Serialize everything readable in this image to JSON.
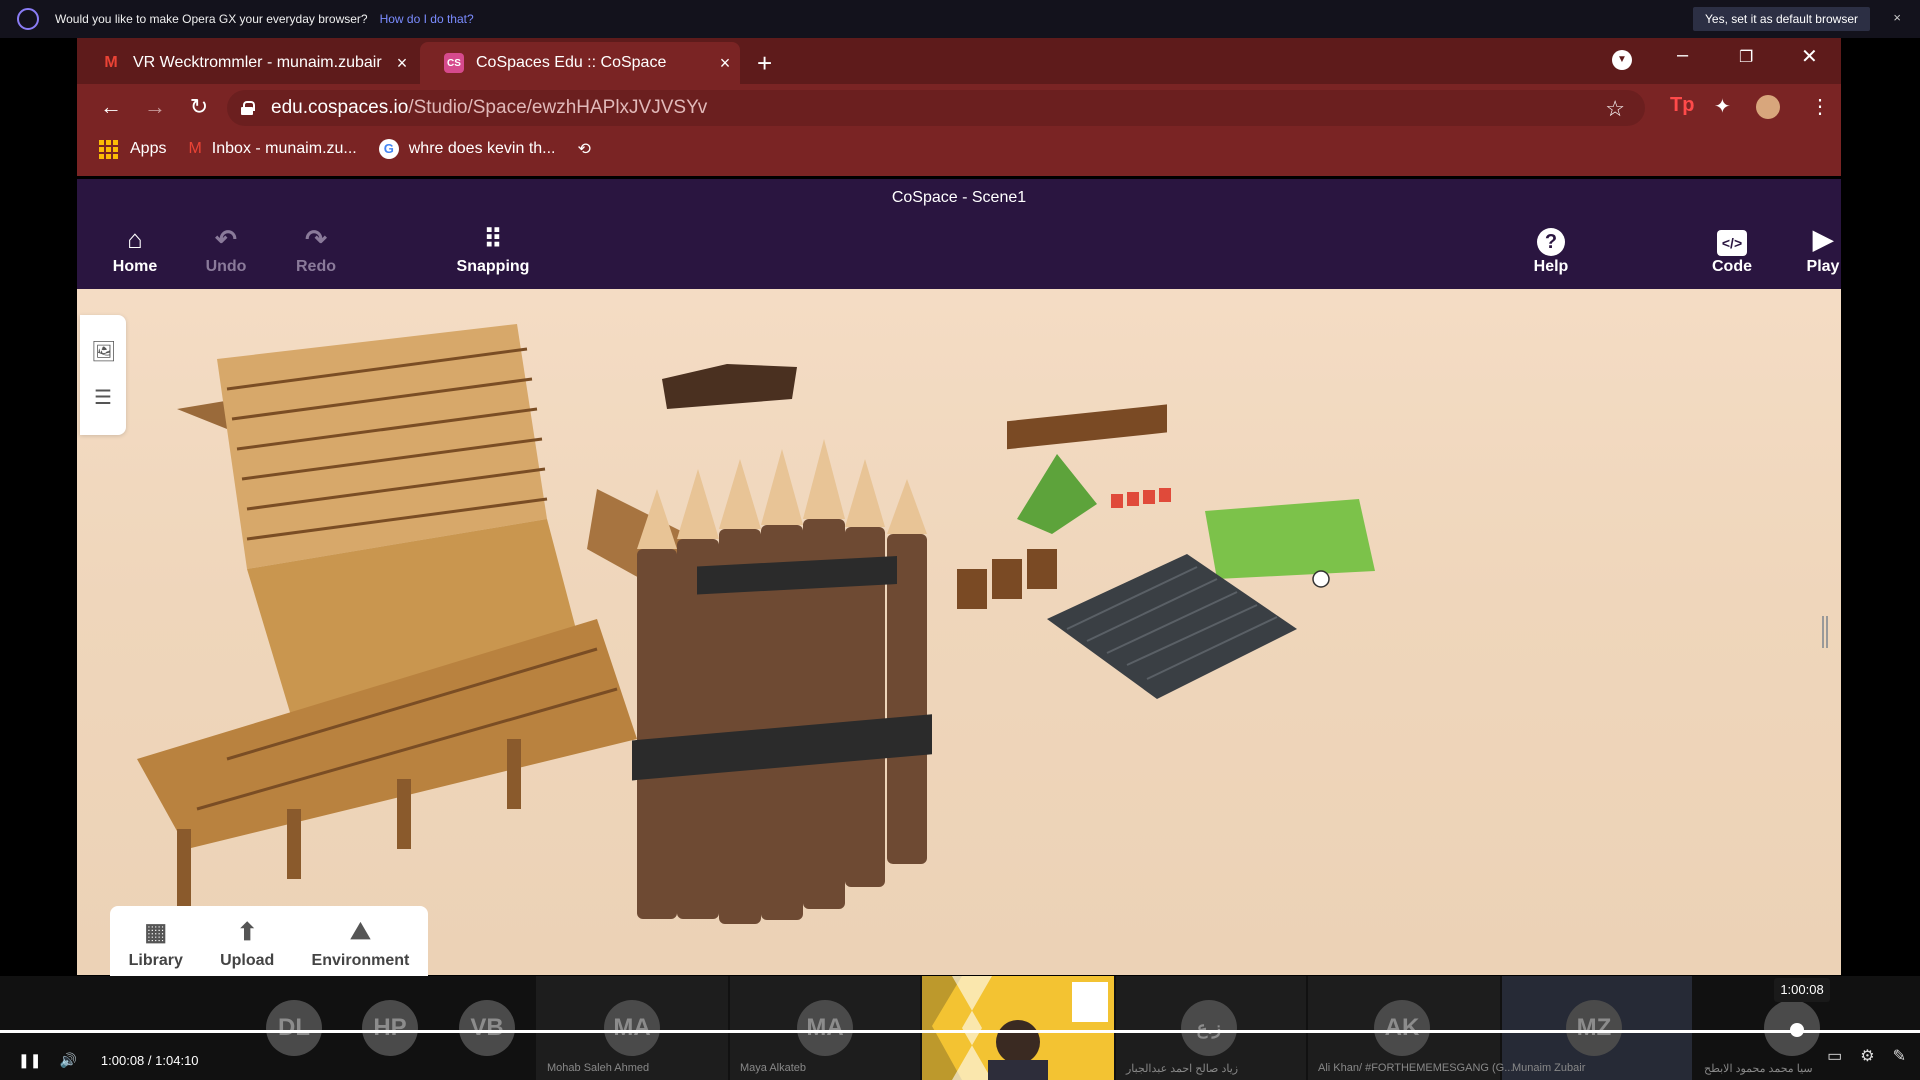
{
  "opera": {
    "prompt": "Would you like to make Opera GX your everyday browser?",
    "link": "How do I do that?",
    "default_button": "Yes, set it as default browser",
    "close": "×"
  },
  "tabs": [
    {
      "title": "VR Wecktrommler - munaim.zubair",
      "close": "×"
    },
    {
      "title": "CoSpaces Edu :: CoSpace",
      "close": "×"
    }
  ],
  "window": {
    "new_tab": "+",
    "minimize": "–",
    "restore": "❐",
    "close": "✕"
  },
  "toolbar": {
    "back": "←",
    "forward": "→",
    "reload": "↻",
    "url_host": "edu.cospaces.io",
    "url_path": "/Studio/Space/ewzhHAPlxJVJVSYv",
    "star": "☆"
  },
  "bookmarks": [
    {
      "label": "Apps"
    },
    {
      "label": "Inbox - munaim.zu..."
    },
    {
      "label": "whre does kevin th..."
    }
  ],
  "app": {
    "scene_title": "CoSpace - Scene1",
    "buttons": {
      "home": "Home",
      "undo": "Undo",
      "redo": "Redo",
      "snapping": "Snapping",
      "help": "Help",
      "code": "Code",
      "play": "Play"
    },
    "bottom": {
      "library": "Library",
      "upload": "Upload",
      "environment": "Environment"
    }
  },
  "meeting": {
    "participants": [
      {
        "initials": "DL",
        "name": ""
      },
      {
        "initials": "HP",
        "name": ""
      },
      {
        "initials": "VB",
        "name": ""
      },
      {
        "initials": "MA",
        "name": "Mohab   Saleh Ahmed"
      },
      {
        "initials": "MA",
        "name": "Maya Alkateb"
      },
      {
        "initials": "ز.ع",
        "name": "زياد صالح احمد عبدالجبار"
      },
      {
        "initials": "AK",
        "name": "Ali Khan/ #FORTHEMEMESGANG (G..."
      },
      {
        "initials": "MZ",
        "name": "Munaim Zubair"
      },
      {
        "initials": "",
        "name": "سيا محمد محمود الابطح"
      }
    ]
  },
  "player": {
    "tooltip": "1:00:08",
    "current": "1:00:08",
    "separator": "/",
    "duration": "1:04:10",
    "progress_fraction": 0.936
  }
}
